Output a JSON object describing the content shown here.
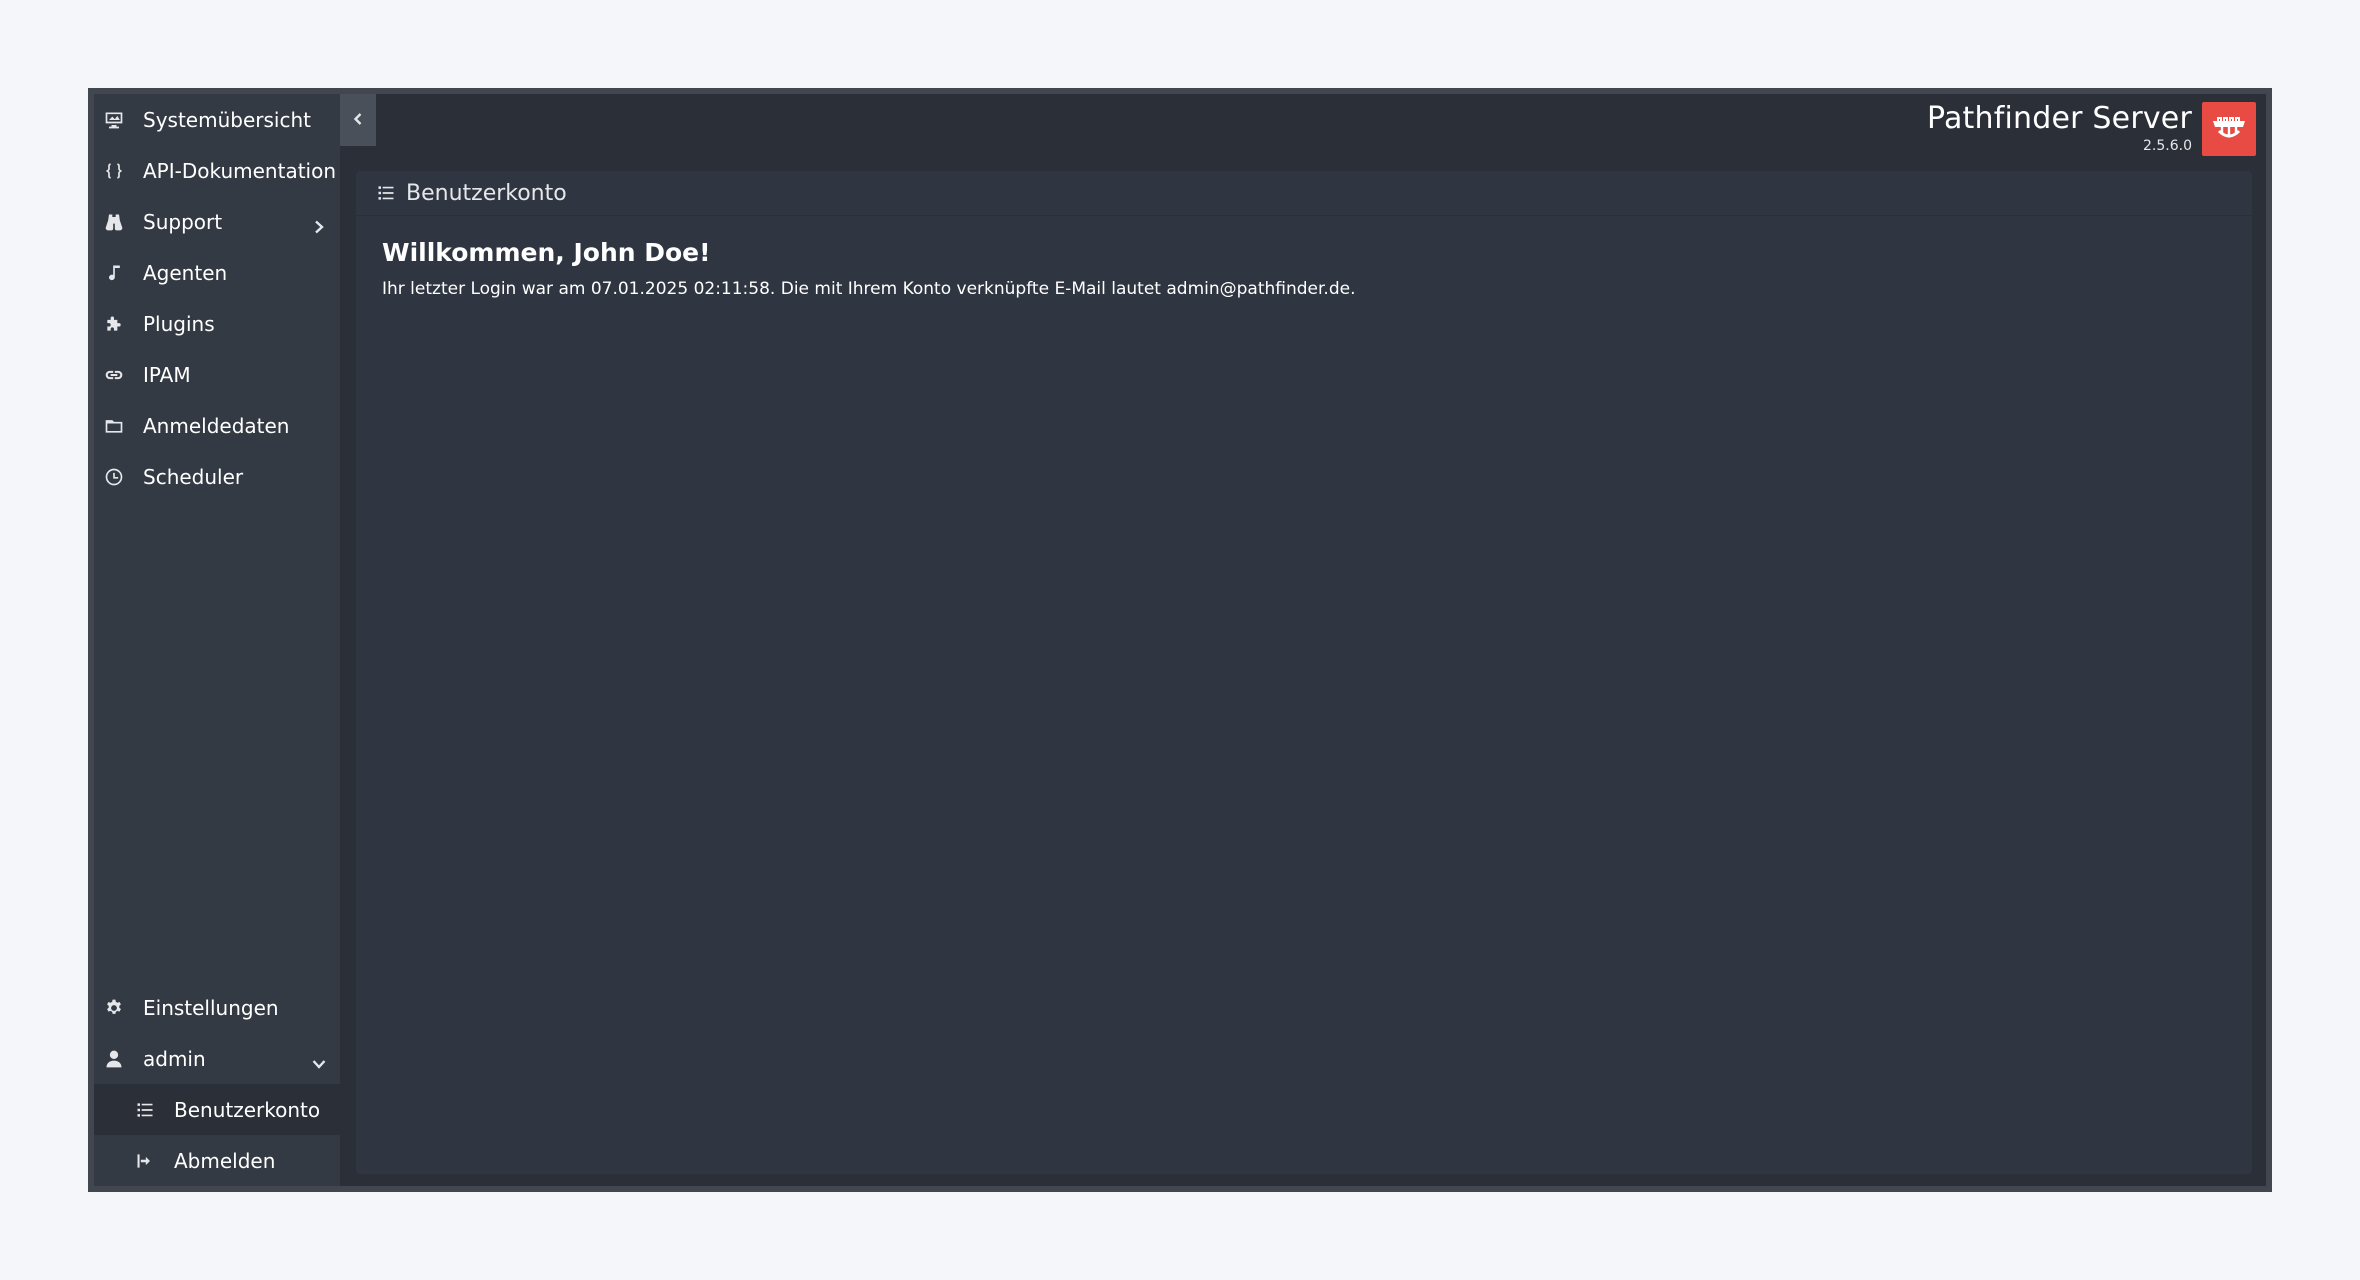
{
  "brand": {
    "title": "Pathfinder Server",
    "version": "2.5.6.0",
    "logo_icon": "pathfinder-logo-icon",
    "logo_color": "#e84b44"
  },
  "sidebar": {
    "items": [
      {
        "label": "Systemübersicht",
        "icon": "monitor-icon"
      },
      {
        "label": "API-Dokumentation",
        "icon": "code-braces-icon"
      },
      {
        "label": "Support",
        "icon": "binoculars-icon",
        "chevron": "chevron-right-icon"
      },
      {
        "label": "Agenten",
        "icon": "music-note-icon"
      },
      {
        "label": "Plugins",
        "icon": "puzzle-icon"
      },
      {
        "label": "IPAM",
        "icon": "link-icon"
      },
      {
        "label": "Anmeldedaten",
        "icon": "folder-icon"
      },
      {
        "label": "Scheduler",
        "icon": "clock-icon"
      }
    ],
    "bottom_items": [
      {
        "label": "Einstellungen",
        "icon": "gear-icon"
      },
      {
        "label": "admin",
        "icon": "user-icon",
        "chevron": "chevron-down-icon"
      }
    ],
    "sub_items": [
      {
        "label": "Benutzerkonto",
        "icon": "list-icon",
        "active": true
      },
      {
        "label": "Abmelden",
        "icon": "logout-icon"
      }
    ]
  },
  "main": {
    "header_title": "Benutzerkonto",
    "header_icon": "list-icon",
    "welcome": "Willkommen, John Doe!",
    "info": "Ihr letzter Login war am 07.01.2025 02:11:58. Die mit Ihrem Konto verknüpfte E-Mail lautet admin@pathfinder.de."
  },
  "colors": {
    "background": "#f5f6fa",
    "sidebar": "#343a43",
    "content": "#2f3541",
    "accent": "#e84b44"
  }
}
